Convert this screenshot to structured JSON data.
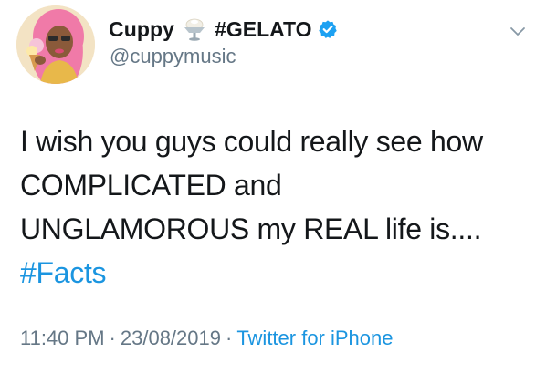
{
  "tweet": {
    "display_name": "Cuppy",
    "name_suffix": "#GELATO",
    "handle": "@cuppymusic",
    "body_lines": [
      "I wish you guys could really see how",
      "COMPLICATED and",
      "UNGLAMOROUS my REAL life is...."
    ],
    "hashtag": "#Facts",
    "time": "11:40 PM",
    "date": "23/08/2019",
    "separator": "·",
    "source": "Twitter for iPhone"
  },
  "icons": {
    "avatar": "profile-avatar",
    "name_emoji": "ice-cream-sundae-icon",
    "verified": "verified-badge-icon",
    "menu": "chevron-down-icon"
  },
  "colors": {
    "text": "#14171a",
    "secondary": "#657786",
    "link": "#1b95e0",
    "verified": "#1da1f2"
  }
}
